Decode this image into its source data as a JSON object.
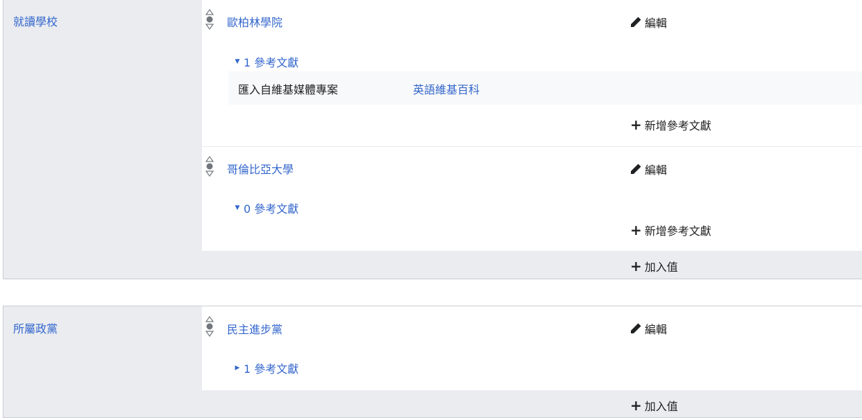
{
  "groups": [
    {
      "property": "就讀學校",
      "statements": [
        {
          "value": "歐柏林學院",
          "edit_label": "編輯",
          "references_toggle": "1 參考文獻",
          "reference": {
            "property": "匯入自維基媒體專案",
            "value": "英語維基百科"
          },
          "add_reference": "新增參考文獻"
        },
        {
          "value": "哥倫比亞大學",
          "edit_label": "編輯",
          "references_toggle": "0 參考文獻",
          "add_reference": "新增參考文獻"
        }
      ],
      "add_value": "加入值"
    },
    {
      "property": "所屬政黨",
      "statements": [
        {
          "value": "民主進步黨",
          "edit_label": "編輯",
          "references_toggle": "1 參考文獻"
        }
      ],
      "add_value": "加入值"
    }
  ],
  "icons": {
    "rank": "rank-normal-icon",
    "edit": "pencil-icon",
    "add": "plus-icon",
    "expanded": "triangle-down-icon",
    "collapsed": "triangle-right-icon"
  },
  "colors": {
    "link": "#3366cc",
    "label_bg": "#eaecf0",
    "reference_bg": "#f8f9fa",
    "border": "#c8ccd1"
  }
}
